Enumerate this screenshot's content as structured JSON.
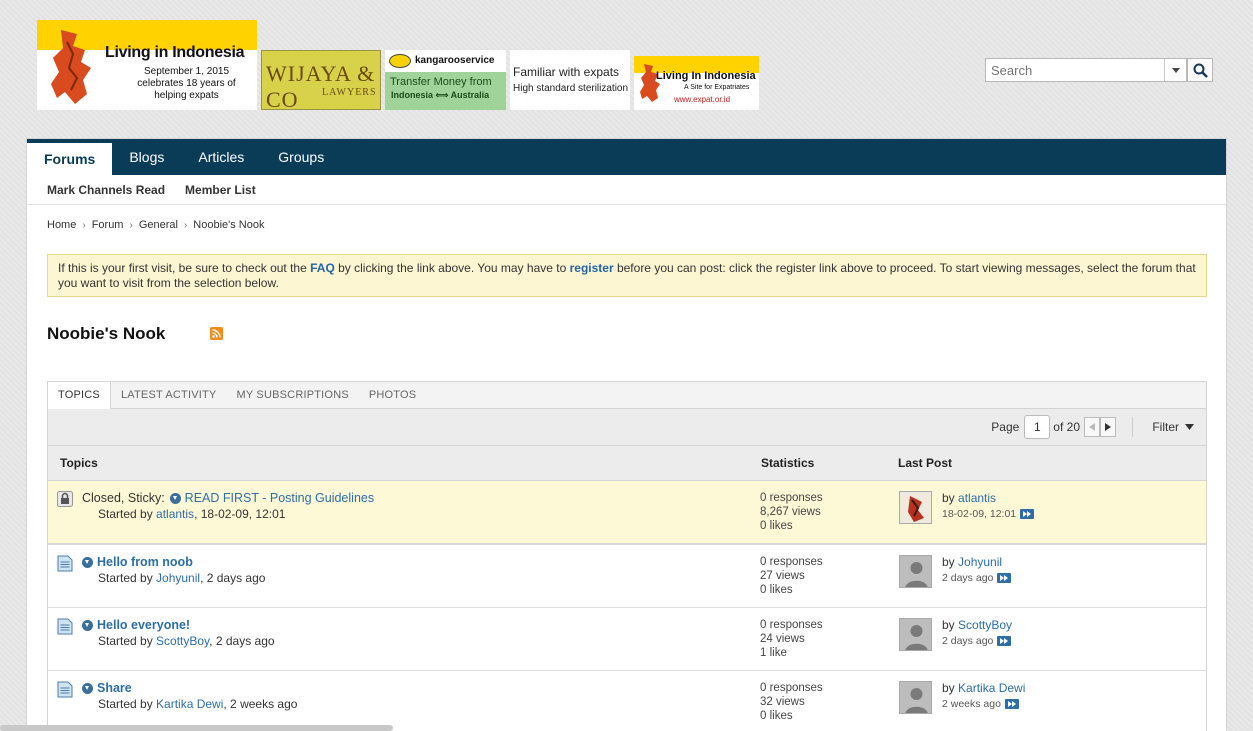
{
  "banners": {
    "b1": {
      "title": "Living in Indonesia",
      "line1": "September 1, 2015",
      "line2": "celebrates 18 years of",
      "line3": "helping expats"
    },
    "b2": {
      "brand": "WIJAYA & CO",
      "sub": "LAWYERS"
    },
    "b3": {
      "brand": "kangarooservice",
      "line1": "Transfer Money from",
      "line2": "Indonesia ⟺ Australia"
    },
    "b4": {
      "line1": "Familiar with expats",
      "line2": "High standard sterilization"
    },
    "b5": {
      "title": "Living In Indonesia",
      "sub": "A Site for Expatriates",
      "url": "www.expat.or.id"
    }
  },
  "search": {
    "placeholder": "Search"
  },
  "nav": {
    "tabs": [
      "Forums",
      "Blogs",
      "Articles",
      "Groups"
    ],
    "active": "Forums"
  },
  "subnav": {
    "items": [
      "Mark Channels Read",
      "Member List"
    ]
  },
  "breadcrumb": [
    "Home",
    "Forum",
    "General",
    "Noobie's Nook"
  ],
  "notice": {
    "p1": "If this is your first visit, be sure to check out the ",
    "faq": "FAQ",
    "p2": " by clicking the link above. You may have to ",
    "register": "register",
    "p3": " before you can post: click the register link above to proceed. To start viewing messages, select the forum that you want to visit from the selection below."
  },
  "page_title": "Noobie's Nook",
  "tabs": [
    "TOPICS",
    "LATEST ACTIVITY",
    "MY SUBSCRIPTIONS",
    "PHOTOS"
  ],
  "pager": {
    "label": "Page",
    "current": "1",
    "total": "of 20",
    "filter": "Filter"
  },
  "columns": {
    "topics": "Topics",
    "statistics": "Statistics",
    "last_post": "Last Post"
  },
  "topics": [
    {
      "prefix": "Closed, Sticky:",
      "title": "READ FIRST - Posting Guidelines",
      "started_by": "Started by ",
      "author": "atlantis",
      "date": ", 18-02-09, 12:01",
      "responses": "0 responses",
      "views": "8,267 views",
      "likes": "0 likes",
      "lp_by": "by ",
      "lp_user": "atlantis",
      "lp_date": "18-02-09, 12:01"
    },
    {
      "prefix": "",
      "title": "Hello from noob",
      "started_by": "Started by ",
      "author": "Johyunil",
      "date": ", 2 days ago",
      "responses": "0 responses",
      "views": "27 views",
      "likes": "0 likes",
      "lp_by": "by ",
      "lp_user": "Johyunil",
      "lp_date": "2 days ago"
    },
    {
      "prefix": "",
      "title": "Hello everyone!",
      "started_by": "Started by ",
      "author": "ScottyBoy",
      "date": ", 2 days ago",
      "responses": "0 responses",
      "views": "24 views",
      "likes": "1 like",
      "lp_by": "by ",
      "lp_user": "ScottyBoy",
      "lp_date": "2 days ago"
    },
    {
      "prefix": "",
      "title": "Share",
      "started_by": "Started by ",
      "author": "Kartika Dewi",
      "date": ", 2 weeks ago",
      "responses": "0 responses",
      "views": "32 views",
      "likes": "0 likes",
      "lp_by": "by ",
      "lp_user": "Kartika Dewi",
      "lp_date": "2 weeks ago"
    }
  ],
  "colors": {
    "nav": "#0a3b57",
    "link": "#2e6ea6",
    "notice_bg": "#fcf6d2",
    "sticky_bg": "#fdf9d6"
  }
}
